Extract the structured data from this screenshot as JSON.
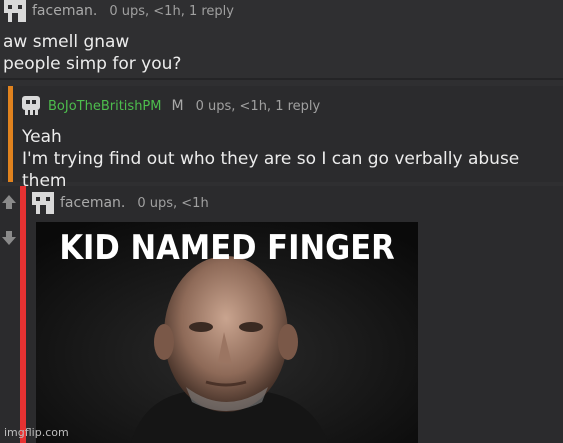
{
  "comments": [
    {
      "username": "faceman.",
      "meta": "0 ups, <1h, 1 reply",
      "lines": [
        "aw smell gnaw",
        "people simp for you?"
      ]
    },
    {
      "username": "BoJoTheBritishPM",
      "flag": "M",
      "meta": "0 ups, <1h, 1 reply",
      "lines": [
        "Yeah",
        "I'm trying find out who they are so I can go verbally abuse them"
      ]
    },
    {
      "username": "faceman.",
      "meta": "0 ups, <1h",
      "meme_caption": "KID NAMED FINGER"
    }
  ],
  "watermark": "imgflip.com",
  "colors": {
    "background": "#2f2f31",
    "reply_stripe": "#e0821e",
    "active_stripe": "#e63232",
    "green_username": "#4dbd4d"
  },
  "icons": [
    "avatar-icon",
    "upvote-icon",
    "downvote-icon"
  ]
}
